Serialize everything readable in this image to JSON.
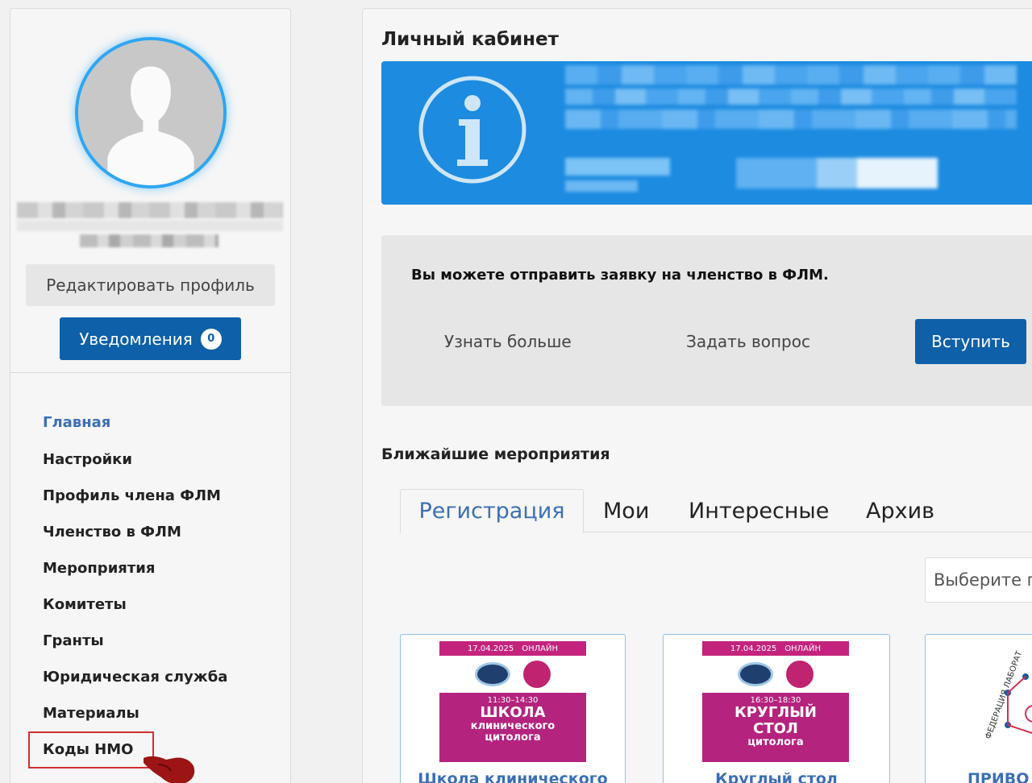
{
  "sidebar": {
    "edit_profile": "Редактировать профиль",
    "notifications": {
      "label": "Уведомления",
      "count": "0"
    },
    "nav": [
      {
        "label": "Главная",
        "active": true
      },
      {
        "label": "Настройки"
      },
      {
        "label": "Профиль члена ФЛМ"
      },
      {
        "label": "Членство в ФЛМ"
      },
      {
        "label": "Мероприятия"
      },
      {
        "label": "Комитеты"
      },
      {
        "label": "Гранты"
      },
      {
        "label": "Юридическая служба"
      },
      {
        "label": "Материалы"
      },
      {
        "label": "Коды НМО"
      }
    ]
  },
  "main": {
    "title": "Личный кабинет",
    "membership": {
      "text": "Вы можете отправить заявку на членство в ФЛМ.",
      "learn_more": "Узнать больше",
      "ask_question": "Задать вопрос",
      "join": "Вступить"
    },
    "events": {
      "title": "Ближайшие мероприятия",
      "tabs": [
        "Регистрация",
        "Мои",
        "Интересные",
        "Архив"
      ],
      "select_placeholder": "Выберите г",
      "cards": [
        {
          "date": "17.04.2025",
          "format": "ОНЛАЙН",
          "time": "11:30–14:30",
          "big": "ШКОЛА",
          "small1": "клинического",
          "small2": "цитолога",
          "title": "Школа клинического"
        },
        {
          "date": "17.04.2025",
          "format": "ОНЛАЙН",
          "time": "16:30–18:30",
          "big1": "КРУГЛЫЙ",
          "big2": "СТОЛ",
          "small": "цитолога",
          "title": "Круглый стол"
        },
        {
          "logo_text": "ФЕДЕРАЦИЯ ЛАБОРАТ",
          "title": "ПРИВО"
        }
      ]
    }
  },
  "colors": {
    "accent": "#0e60a8",
    "info_banner": "#1d8be0",
    "link": "#3b6fb5",
    "highlight": "#d03030"
  }
}
